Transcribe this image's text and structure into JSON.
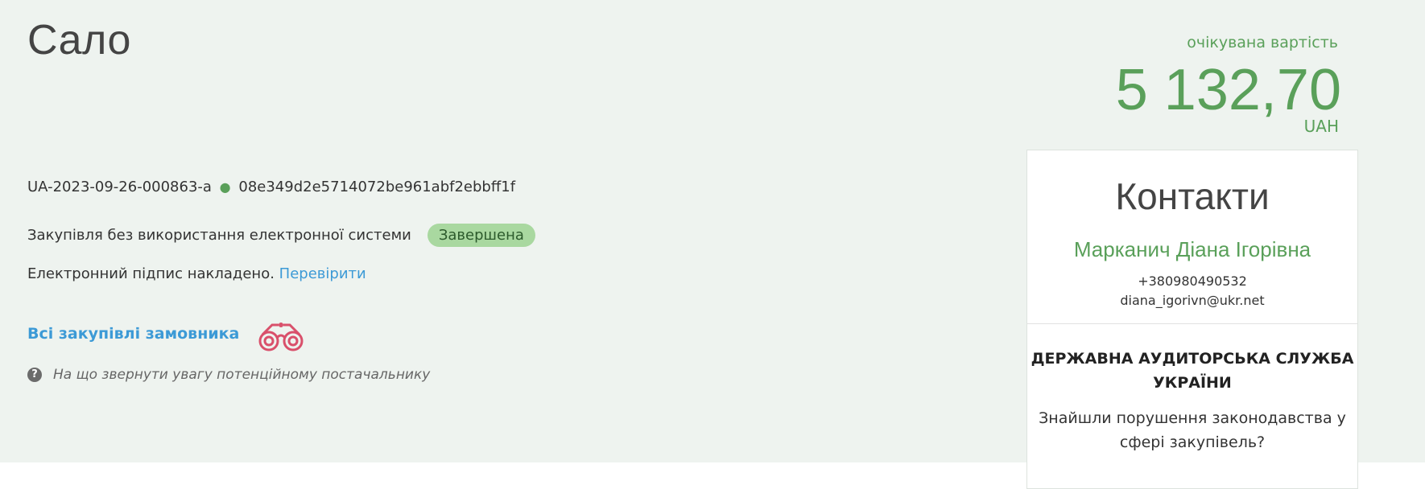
{
  "tender": {
    "title": "Сало",
    "tender_id": "UA-2023-09-26-000863-a",
    "hash": "08e349d2e5714072be961abf2ebbff1f",
    "procedure_type": "Закупівля без використання електронної системи",
    "status": "Завершена",
    "signature_text": "Електронний підпис накладено.",
    "verify_link": "Перевірити",
    "all_purchases_link": "Всі закупівлі замовника",
    "hint_text": "На що звернути увагу потенційному постачальнику"
  },
  "expected_value": {
    "label": "очікувана вартість",
    "amount": "5 132,70",
    "currency": "UAH"
  },
  "contacts": {
    "title": "Контакти",
    "name": "Марканич Діана Ігорівна",
    "phone": "+380980490532",
    "email": "diana_igorivn@ukr.net"
  },
  "audit": {
    "title": "ДЕРЖАВНА АУДИТОРСЬКА СЛУЖБА УКРАЇНИ",
    "text": "Знайшли порушення законодавства у сфері закупівель?"
  },
  "colors": {
    "accent_green": "#5aa05a",
    "link_blue": "#3c9ad6",
    "badge_bg": "#a9d8a0",
    "panel_bg": "#eef3ef",
    "binoculars": "#d9506b"
  },
  "icons": {
    "binoculars": "binoculars-icon",
    "hint": "question-circle-icon"
  }
}
